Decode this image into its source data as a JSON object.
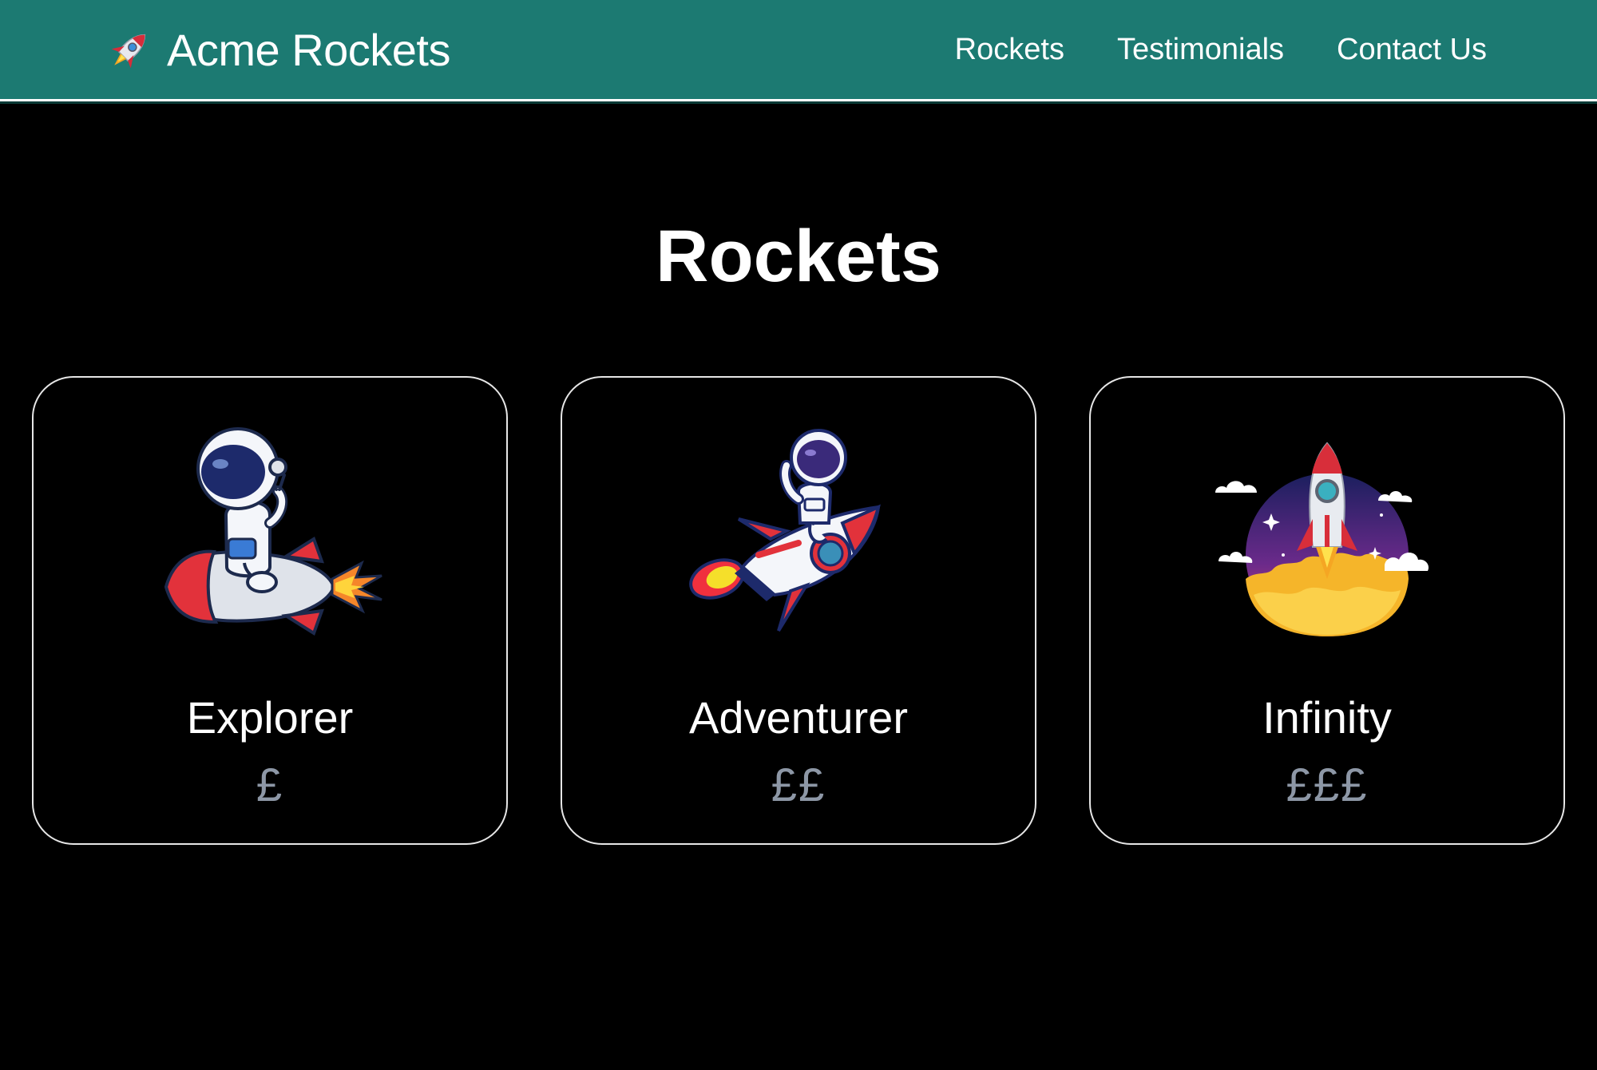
{
  "brand": {
    "name": "Acme Rockets",
    "icon": "rocket-icon"
  },
  "nav": {
    "links": [
      "Rockets",
      "Testimonials",
      "Contact Us"
    ]
  },
  "main": {
    "title": "Rockets"
  },
  "cards": [
    {
      "name": "Explorer",
      "price": "£",
      "image": "astronaut-riding-rocket"
    },
    {
      "name": "Adventurer",
      "price": "££",
      "image": "astronaut-flying-rocket"
    },
    {
      "name": "Infinity",
      "price": "£££",
      "image": "rocket-launch-badge"
    }
  ],
  "colors": {
    "header": "#1c7a72",
    "background": "#000000",
    "price": "#8d97a6",
    "card_border": "#e6e6e6"
  }
}
